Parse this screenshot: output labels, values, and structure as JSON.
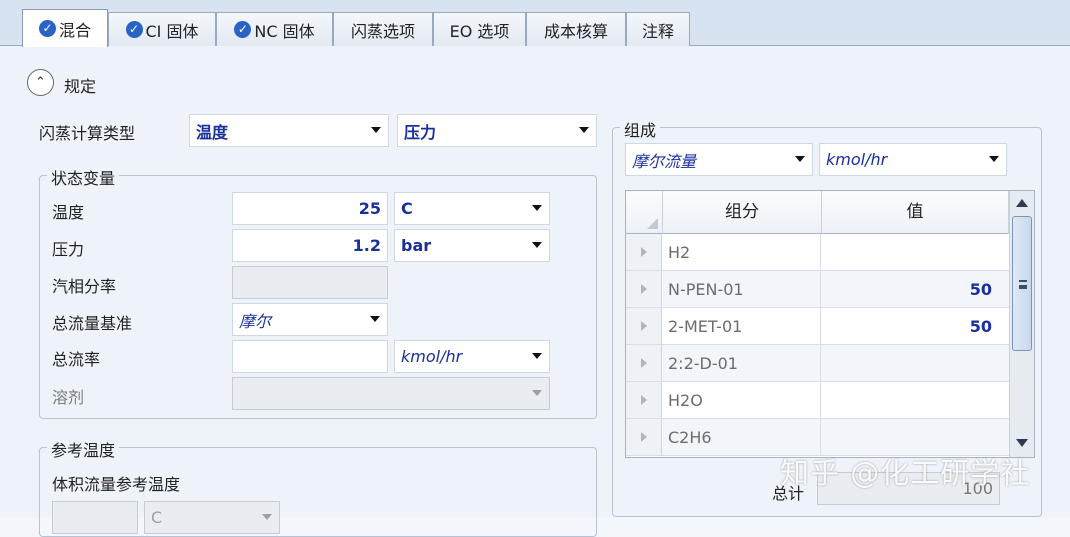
{
  "tabs": [
    {
      "label": "混合",
      "checked": true,
      "active": true
    },
    {
      "label": "CI 固体",
      "checked": true,
      "active": false
    },
    {
      "label": "NC 固体",
      "checked": true,
      "active": false
    },
    {
      "label": "闪蒸选项",
      "checked": false,
      "active": false
    },
    {
      "label": "EO 选项",
      "checked": false,
      "active": false
    },
    {
      "label": "成本核算",
      "checked": false,
      "active": false
    },
    {
      "label": "注释",
      "checked": false,
      "active": false
    }
  ],
  "section": {
    "title": "规定"
  },
  "flash": {
    "label": "闪蒸计算类型",
    "spec1": "温度",
    "spec2": "压力"
  },
  "state_vars": {
    "title": "状态变量",
    "temperature": {
      "label": "温度",
      "value": "25",
      "unit": "C"
    },
    "pressure": {
      "label": "压力",
      "value": "1.2",
      "unit": "bar"
    },
    "vapor_fraction": {
      "label": "汽相分率",
      "value": ""
    },
    "total_flow_basis": {
      "label": "总流量基准",
      "value": "摩尔"
    },
    "total_flow_rate": {
      "label": "总流率",
      "value": "",
      "unit": "kmol/hr"
    },
    "solvent": {
      "label": "溶剂",
      "value": ""
    }
  },
  "ref_temp": {
    "title": "参考温度",
    "volume_flow_label": "体积流量参考温度",
    "unit": "C"
  },
  "composition": {
    "title": "组成",
    "basis": "摩尔流量",
    "unit": "kmol/hr",
    "columns": [
      "组分",
      "值"
    ],
    "rows": [
      {
        "component": "H2",
        "value": ""
      },
      {
        "component": "N-PEN-01",
        "value": "50"
      },
      {
        "component": "2-MET-01",
        "value": "50"
      },
      {
        "component": "2:2-D-01",
        "value": ""
      },
      {
        "component": "H2O",
        "value": ""
      },
      {
        "component": "C2H6",
        "value": ""
      }
    ],
    "total_label": "总计",
    "total_value": "100"
  },
  "watermark": "知乎 @化工研学社",
  "colors": {
    "accent": "#1a2f9e",
    "check": "#2a63c6",
    "tab_bg": "#d8e3f1"
  },
  "icons": {
    "tab_check": "check-circle-icon",
    "collapse": "chevron-up-icon",
    "dropdown": "caret-down-icon"
  }
}
